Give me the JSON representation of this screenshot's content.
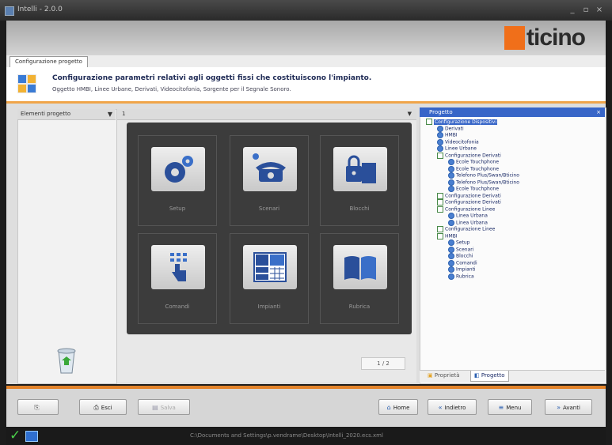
{
  "window": {
    "title": "Intelli - 2.0.0",
    "controls": [
      "_",
      "▫",
      "×"
    ]
  },
  "brand": {
    "logo_text": "ticino",
    "accent": "#f06f1a"
  },
  "tab": {
    "label": "Configurazione progetto"
  },
  "header": {
    "title": "Configurazione parametri relativi agli oggetti fissi che costituiscono l'impianto.",
    "subtitle": "Oggetto HMBI, Linee Urbane, Derivati, Videocitofonia, Sorgente per il Segnale Sonoro."
  },
  "left_panel": {
    "title": "Elementi progetto",
    "pin": "▼",
    "trash_icon": "recycle-bin-icon"
  },
  "center": {
    "title": "1",
    "dropdown": "▼",
    "tiles": [
      {
        "label": "Setup",
        "icon": "gears-icon"
      },
      {
        "label": "Scenari",
        "icon": "telephone-icon"
      },
      {
        "label": "Blocchi",
        "icon": "lock-icon"
      },
      {
        "label": "Comandi",
        "icon": "touch-keypad-icon"
      },
      {
        "label": "Impianti",
        "icon": "layout-icon"
      },
      {
        "label": "Rubrica",
        "icon": "book-icon"
      }
    ],
    "pager": "1 / 2"
  },
  "right_panel": {
    "title": "Progetto",
    "tree": [
      {
        "label": "Configurazione Dispositivi",
        "level": 1,
        "kind": "folder",
        "selected": true
      },
      {
        "label": "Derivati",
        "level": 2,
        "kind": "leaf"
      },
      {
        "label": "HMBI",
        "level": 2,
        "kind": "leaf"
      },
      {
        "label": "Videocitofonia",
        "level": 2,
        "kind": "leaf"
      },
      {
        "label": "Linee Urbane",
        "level": 2,
        "kind": "leaf"
      },
      {
        "label": "Configurazione Derivati",
        "level": 2,
        "kind": "folder"
      },
      {
        "label": "Ecole Touchphone",
        "level": 3,
        "kind": "leaf"
      },
      {
        "label": "Ecole Touchphone",
        "level": 3,
        "kind": "leaf"
      },
      {
        "label": "Telefono Plus/Swan/Bticino",
        "level": 3,
        "kind": "leaf"
      },
      {
        "label": "Telefono Plus/Swan/Bticino",
        "level": 3,
        "kind": "leaf"
      },
      {
        "label": "Ecole Touchphone",
        "level": 3,
        "kind": "leaf"
      },
      {
        "label": "Configurazione Derivati",
        "level": 2,
        "kind": "folder"
      },
      {
        "label": "Configurazione Derivati",
        "level": 2,
        "kind": "folder"
      },
      {
        "label": "Configurazione Linee",
        "level": 2,
        "kind": "folder"
      },
      {
        "label": "Linea Urbana",
        "level": 3,
        "kind": "leaf"
      },
      {
        "label": "Linea Urbana",
        "level": 3,
        "kind": "leaf"
      },
      {
        "label": "Configurazione Linee",
        "level": 2,
        "kind": "folder"
      },
      {
        "label": "HMBI",
        "level": 2,
        "kind": "folder"
      },
      {
        "label": "Setup",
        "level": 3,
        "kind": "leaf"
      },
      {
        "label": "Scenari",
        "level": 3,
        "kind": "leaf"
      },
      {
        "label": "Blocchi",
        "level": 3,
        "kind": "leaf"
      },
      {
        "label": "Comandi",
        "level": 3,
        "kind": "leaf"
      },
      {
        "label": "Impianti",
        "level": 3,
        "kind": "leaf"
      },
      {
        "label": "Rubrica",
        "level": 3,
        "kind": "leaf"
      }
    ],
    "tabs": [
      {
        "label": "Proprietà",
        "active": false
      },
      {
        "label": "Progetto",
        "active": true
      }
    ]
  },
  "toolbar": {
    "buttons": [
      {
        "label": "",
        "icon": "new-file-icon",
        "disabled": false
      },
      {
        "label": "Esci",
        "icon": "print-icon",
        "disabled": false
      },
      {
        "label": "Salva",
        "icon": "save-icon",
        "disabled": true
      },
      {
        "label": "Home",
        "icon": "home-icon",
        "disabled": false
      },
      {
        "label": "Indietro",
        "icon": "back-icon",
        "disabled": false
      },
      {
        "label": "Menu",
        "icon": "menu-icon",
        "disabled": false
      },
      {
        "label": "Avanti",
        "icon": "forward-icon",
        "disabled": false
      }
    ]
  },
  "status": {
    "path": "C:\\Documents and Settings\\p.vendrame\\Desktop\\Intelli_2020.ecs.xml"
  }
}
